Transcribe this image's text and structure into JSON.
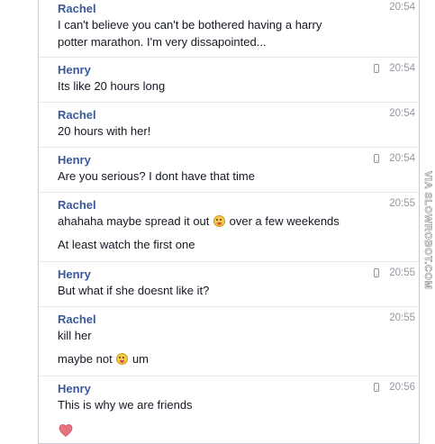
{
  "messages": [
    {
      "sender": "Rachel",
      "time": "20:54",
      "mobile": false,
      "lines": [
        "I can't believe you can't be bothered having a harry",
        "potter marathon. I'm very dissapointed..."
      ]
    },
    {
      "sender": "Henry",
      "time": "20:54",
      "mobile": true,
      "lines": [
        "Its like 20 hours long"
      ]
    },
    {
      "sender": "Rachel",
      "time": "20:54",
      "mobile": false,
      "lines": [
        "20 hours with her!"
      ]
    },
    {
      "sender": "Henry",
      "time": "20:54",
      "mobile": true,
      "lines": [
        "Are you serious? I dont have that time"
      ]
    },
    {
      "sender": "Rachel",
      "time": "20:55",
      "mobile": false,
      "line1_before": "ahahaha maybe spread it out",
      "line1_after": "over a few weekends",
      "line2": "At least watch the first one"
    },
    {
      "sender": "Henry",
      "time": "20:55",
      "mobile": true,
      "lines": [
        "But what if she doesnt like it?"
      ]
    },
    {
      "sender": "Rachel",
      "time": "20:55",
      "mobile": false,
      "line1": "kill her",
      "line2_before": "maybe not",
      "line2_after": "um"
    },
    {
      "sender": "Henry",
      "time": "20:56",
      "mobile": true,
      "lines": [
        "This is why we are friends"
      ]
    }
  ],
  "icons": {
    "phone": "mobile-phone-icon",
    "emoji": "tongue-out-emoji-icon",
    "heart": "heart-icon"
  },
  "colors": {
    "sender_name": "#3b5998",
    "text": "#141823",
    "time": "#9197a3",
    "heart": "#e9737f"
  },
  "watermark": "VIA SLOWROBOT.COM"
}
